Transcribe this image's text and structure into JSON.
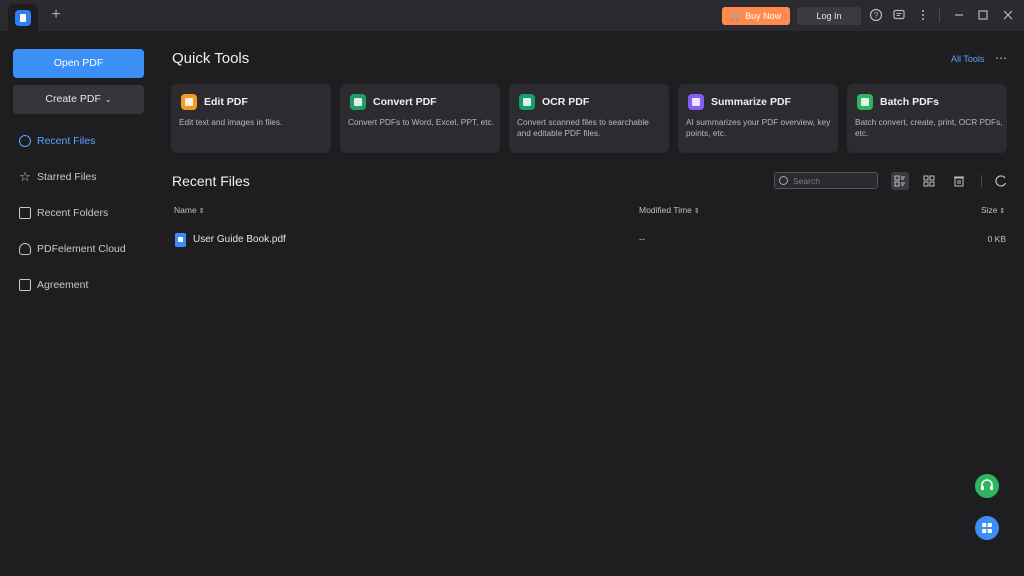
{
  "titlebar": {
    "new_tab_symbol": "+",
    "buy_now": "Buy Now",
    "log_in": "Log In"
  },
  "sidebar": {
    "open_pdf": "Open PDF",
    "create_pdf": "Create PDF",
    "items": [
      {
        "label": "Recent Files",
        "icon": "clock-icon",
        "active": true
      },
      {
        "label": "Starred Files",
        "icon": "star-icon",
        "active": false
      },
      {
        "label": "Recent Folders",
        "icon": "folder-icon",
        "active": false
      },
      {
        "label": "PDFelement Cloud",
        "icon": "cloud-icon",
        "active": false
      },
      {
        "label": "Agreement",
        "icon": "agreement-icon",
        "active": false
      }
    ]
  },
  "quick_tools": {
    "title": "Quick Tools",
    "all_tools": "All Tools",
    "cards": [
      {
        "title": "Edit PDF",
        "desc": "Edit text and images in files.",
        "icon": "edit-pdf-icon",
        "color": "#f59a23"
      },
      {
        "title": "Convert PDF",
        "desc": "Convert PDFs to Word, Excel, PPT, etc.",
        "icon": "convert-pdf-icon",
        "color": "#1e9e6a"
      },
      {
        "title": "OCR PDF",
        "desc": "Convert scanned files to searchable and editable PDF files.",
        "icon": "ocr-pdf-icon",
        "color": "#14a06e"
      },
      {
        "title": "Summarize PDF",
        "desc": "AI summarizes your PDF overview, key points, etc.",
        "icon": "summarize-pdf-icon",
        "color": "#8a5cf6"
      },
      {
        "title": "Batch PDFs",
        "desc": "Batch convert, create, print, OCR PDFs, etc.",
        "icon": "batch-pdfs-icon",
        "color": "#2fb55f"
      }
    ]
  },
  "recent": {
    "title": "Recent Files",
    "search_placeholder": "Search",
    "columns": {
      "name": "Name",
      "modified": "Modified Time",
      "size": "Size"
    },
    "rows": [
      {
        "name": "User Guide Book.pdf",
        "modified": "--",
        "size": "0 KB"
      }
    ]
  },
  "colors": {
    "accent": "#3b8ff5",
    "buy_now": "#ff8a4c",
    "support_fab": "#2fb55f",
    "tools_fab": "#3b8ff5"
  }
}
